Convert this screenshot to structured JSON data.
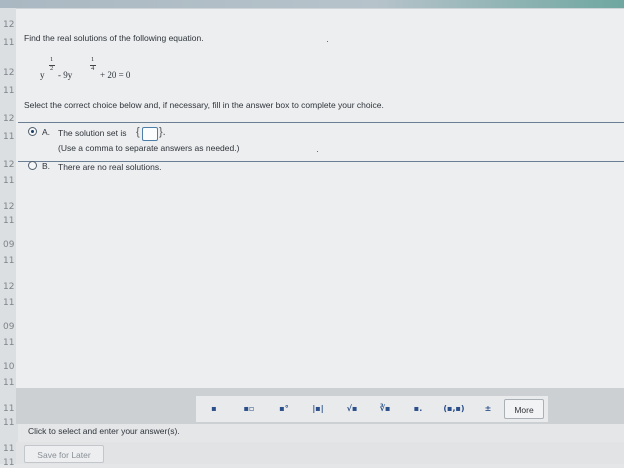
{
  "gutter_labels": [
    "12",
    "11",
    "12",
    "11",
    "12",
    "11",
    "12",
    "11",
    "12",
    "11",
    "09",
    "11",
    "12",
    "11",
    "09",
    "11",
    "10",
    "11",
    "11",
    "11",
    "11",
    "11"
  ],
  "question": {
    "prompt": "Find the real solutions of the following equation.",
    "equation": {
      "base1": "y",
      "exp1_num": "1",
      "exp1_den": "2",
      "middle": "- 9y",
      "exp2_num": "1",
      "exp2_den": "4",
      "tail": "+ 20 = 0"
    },
    "instruction": "Select the correct choice below and, if necessary, fill in the answer box to complete your choice."
  },
  "choices": [
    {
      "letter": "A.",
      "text": "The solution set is",
      "open_brace": "{",
      "close_brace": "}.",
      "subtext": "(Use a comma to separate answers as needed.)",
      "selected": true
    },
    {
      "letter": "B.",
      "text": "There are no real solutions.",
      "selected": false
    }
  ],
  "toolbar": {
    "tools": [
      {
        "icon": "fraction-icon",
        "glyph": "▪"
      },
      {
        "icon": "mixed-number-icon",
        "glyph": "▪▫"
      },
      {
        "icon": "exponent-icon",
        "glyph": "▪°"
      },
      {
        "icon": "absolute-value-icon",
        "glyph": "|▪|"
      },
      {
        "icon": "square-root-icon",
        "glyph": "√▪"
      },
      {
        "icon": "nth-root-icon",
        "glyph": "∛▪"
      },
      {
        "icon": "decimal-icon",
        "glyph": "▪."
      },
      {
        "icon": "ordered-pair-icon",
        "glyph": "(▪,▪)"
      },
      {
        "icon": "plus-minus-icon",
        "glyph": "±"
      }
    ],
    "more_label": "More"
  },
  "hint": "Click to select and enter your answer(s).",
  "save_label": "Save for Later",
  "colors": {
    "accent": "#1b3e66",
    "separator": "#6a7f94",
    "toolbar_bg": "#cdd0d3"
  }
}
